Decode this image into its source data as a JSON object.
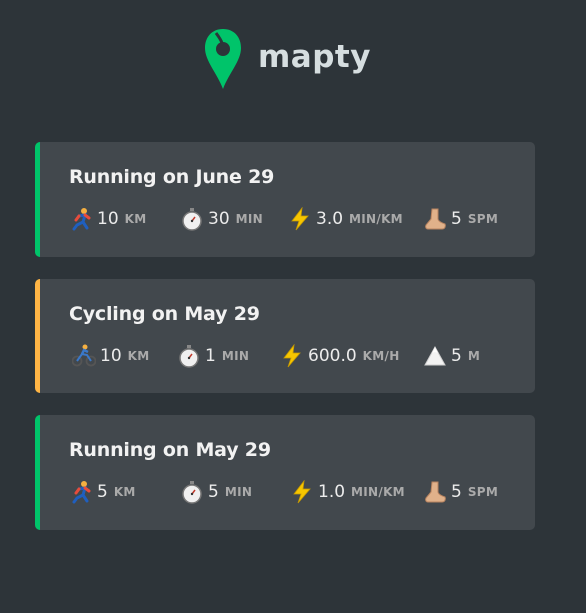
{
  "app": {
    "logo_text": "mapty",
    "brand_colors": {
      "running": "#00c46a",
      "cycling": "#ffb545",
      "background": "#2d3439",
      "card": "#42484d"
    }
  },
  "workouts": [
    {
      "type": "running",
      "title": "Running on June 29",
      "details": [
        {
          "icon": "runner-icon",
          "value": "10",
          "unit": "km"
        },
        {
          "icon": "stopwatch-icon",
          "value": "30",
          "unit": "min"
        },
        {
          "icon": "lightning-icon",
          "value": "3.0",
          "unit": "min/km"
        },
        {
          "icon": "footprint-icon",
          "value": "5",
          "unit": "spm"
        }
      ]
    },
    {
      "type": "cycling",
      "title": "Cycling on May 29",
      "details": [
        {
          "icon": "cyclist-icon",
          "value": "10",
          "unit": "km"
        },
        {
          "icon": "stopwatch-icon",
          "value": "1",
          "unit": "min"
        },
        {
          "icon": "lightning-icon",
          "value": "600.0",
          "unit": "km/h"
        },
        {
          "icon": "mountain-icon",
          "value": "5",
          "unit": "m"
        }
      ]
    },
    {
      "type": "running",
      "title": "Running on May 29",
      "details": [
        {
          "icon": "runner-icon",
          "value": "5",
          "unit": "km"
        },
        {
          "icon": "stopwatch-icon",
          "value": "5",
          "unit": "min"
        },
        {
          "icon": "lightning-icon",
          "value": "1.0",
          "unit": "min/km"
        },
        {
          "icon": "footprint-icon",
          "value": "5",
          "unit": "spm"
        }
      ]
    }
  ]
}
